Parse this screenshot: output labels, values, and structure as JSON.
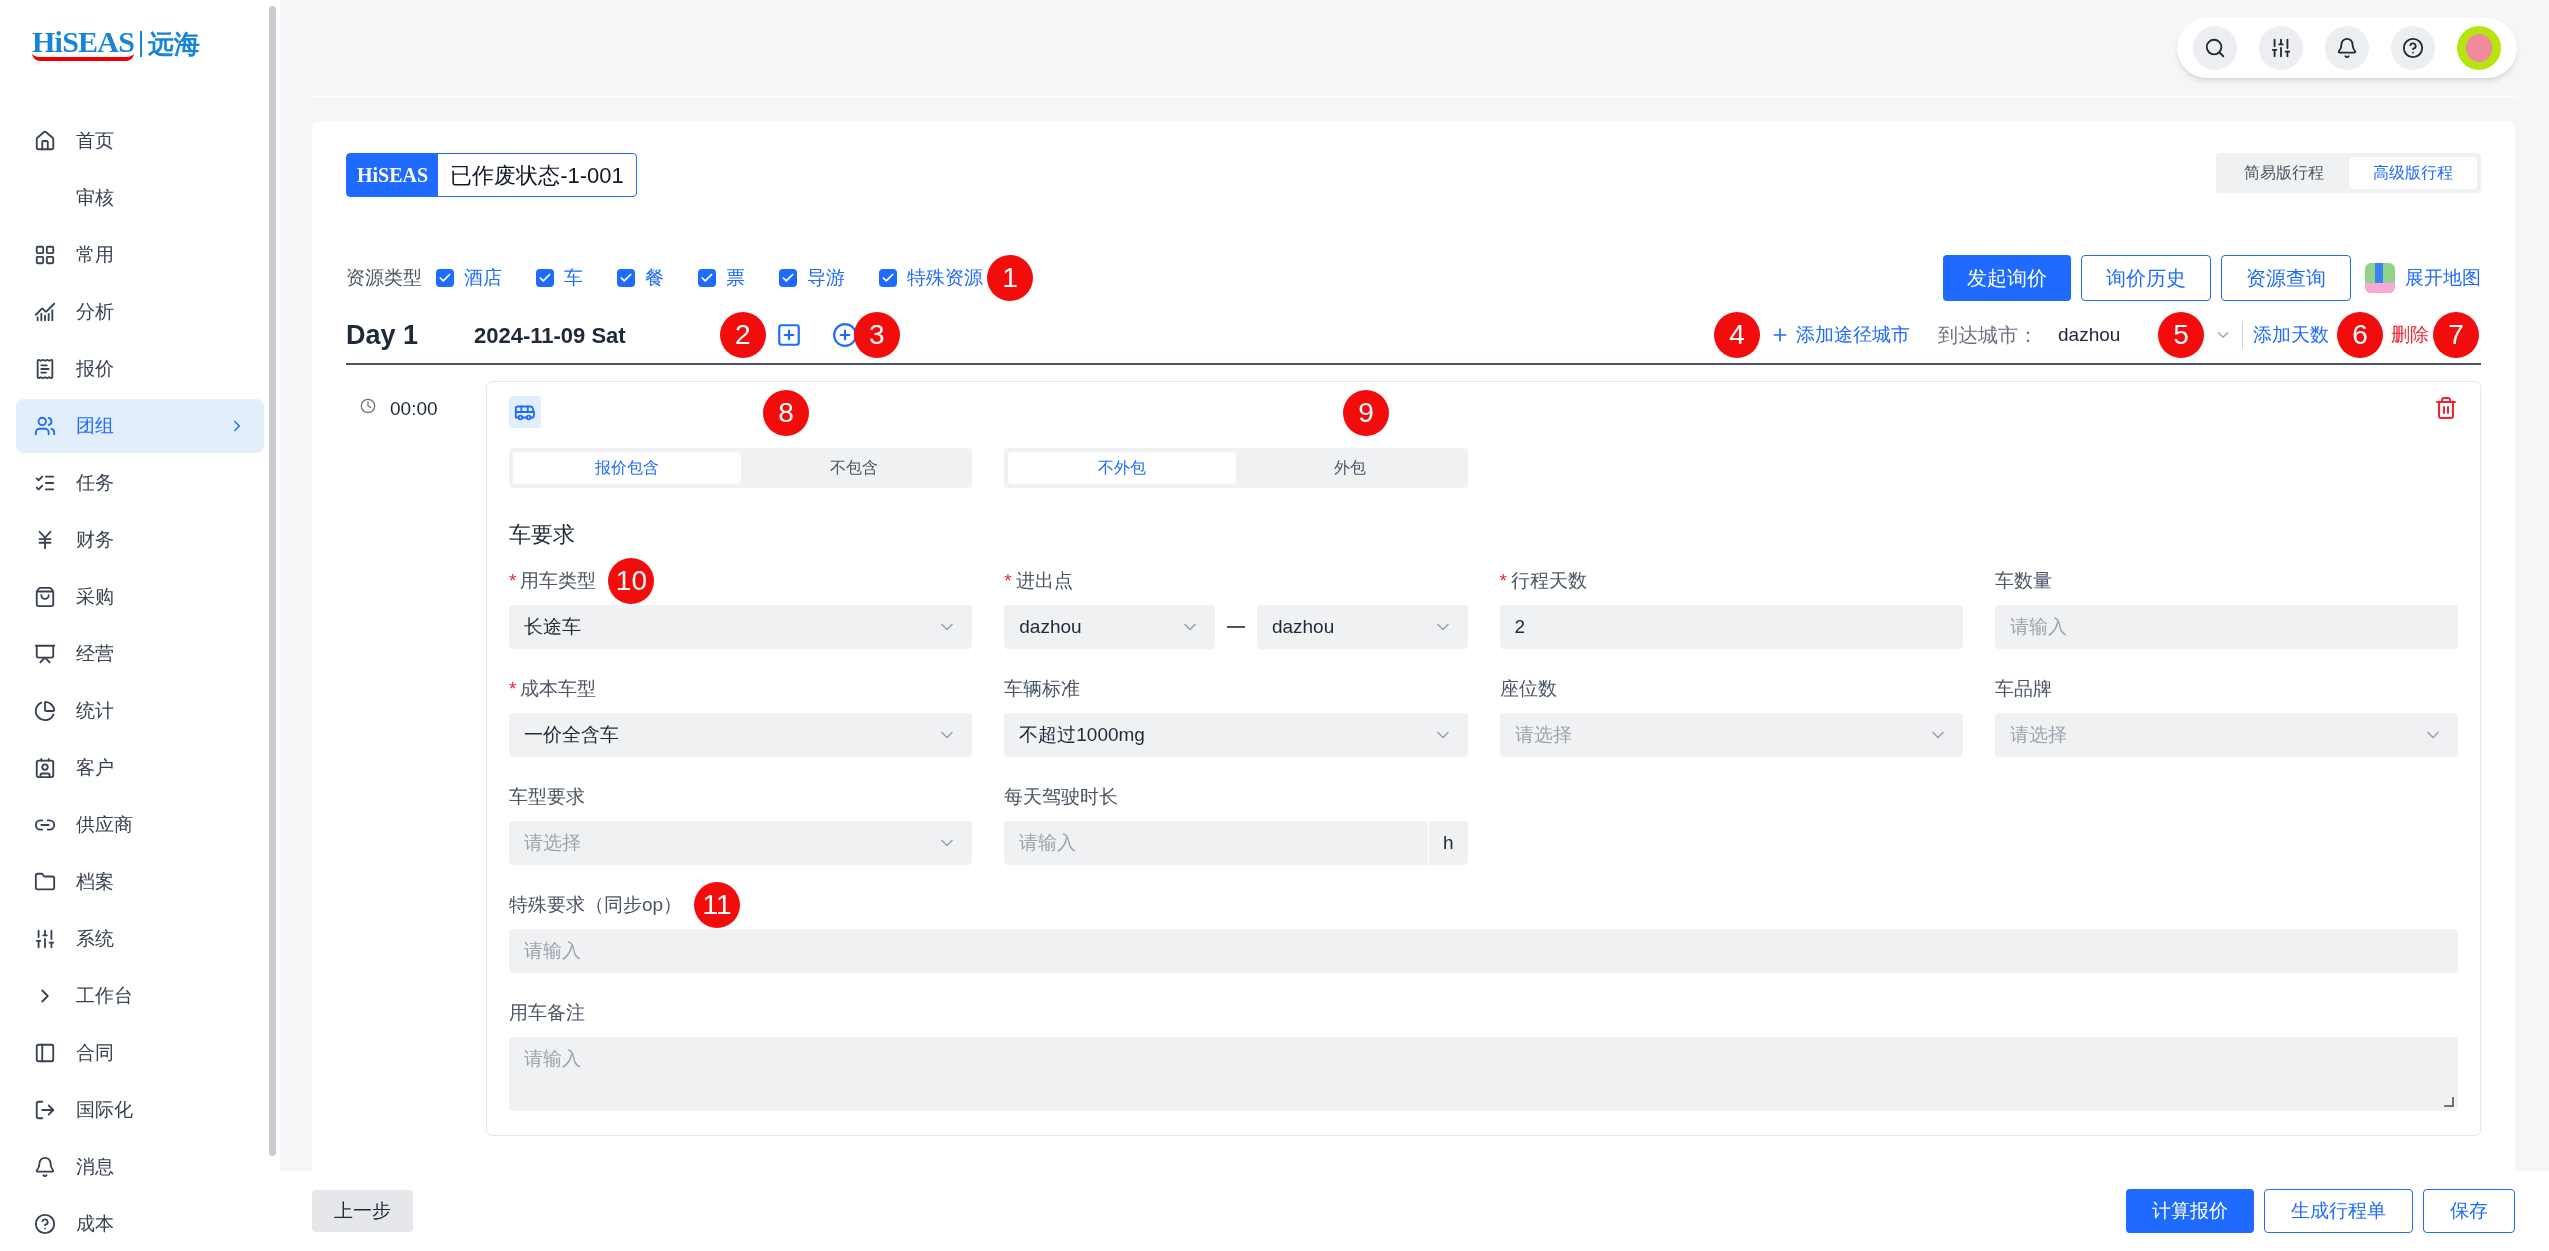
{
  "logo": {
    "latin": "HiSEAS",
    "chinese": "远海"
  },
  "sidebar": {
    "items": [
      {
        "label": "首页",
        "selected": false,
        "expandable": false
      },
      {
        "label": "审核",
        "selected": false,
        "expandable": false
      },
      {
        "label": "常用",
        "selected": false,
        "expandable": false
      },
      {
        "label": "分析",
        "selected": false,
        "expandable": false
      },
      {
        "label": "报价",
        "selected": false,
        "expandable": false
      },
      {
        "label": "团组",
        "selected": true,
        "expandable": true
      },
      {
        "label": "任务",
        "selected": false,
        "expandable": false
      },
      {
        "label": "财务",
        "selected": false,
        "expandable": false
      },
      {
        "label": "采购",
        "selected": false,
        "expandable": false
      },
      {
        "label": "经营",
        "selected": false,
        "expandable": false
      },
      {
        "label": "统计",
        "selected": false,
        "expandable": false
      },
      {
        "label": "客户",
        "selected": false,
        "expandable": false
      },
      {
        "label": "供应商",
        "selected": false,
        "expandable": false
      },
      {
        "label": "档案",
        "selected": false,
        "expandable": false
      },
      {
        "label": "系统",
        "selected": false,
        "expandable": false
      },
      {
        "label": "工作台",
        "selected": false,
        "expandable": false
      },
      {
        "label": "合同",
        "selected": false,
        "expandable": false
      },
      {
        "label": "国际化",
        "selected": false,
        "expandable": false
      },
      {
        "label": "消息",
        "selected": false,
        "expandable": false
      },
      {
        "label": "成本",
        "selected": false,
        "expandable": false
      }
    ]
  },
  "order": {
    "brand": "HiSEAS",
    "title": "已作废状态-1-001"
  },
  "view_toggle": [
    {
      "label": "简易版行程",
      "selected": false
    },
    {
      "label": "高级版行程",
      "selected": true
    }
  ],
  "resource_types": {
    "label": "资源类型",
    "options": [
      {
        "label": "酒店",
        "checked": true
      },
      {
        "label": "车",
        "checked": true
      },
      {
        "label": "餐",
        "checked": true
      },
      {
        "label": "票",
        "checked": true
      },
      {
        "label": "导游",
        "checked": true
      },
      {
        "label": "特殊资源",
        "checked": true
      }
    ]
  },
  "actions": [
    {
      "label": "发起询价",
      "primary": true
    },
    {
      "label": "询价历史",
      "primary": false
    },
    {
      "label": "资源查询",
      "primary": false
    }
  ],
  "map_link": "展开地图",
  "day": {
    "title": "Day 1",
    "date": "2024-11-09 Sat",
    "add_city": "添加途径城市",
    "arrival_label": "到达城市：",
    "arrival_value": "dazhou",
    "add_days": "添加天数",
    "delete": "删除"
  },
  "callouts": [
    "1",
    "2",
    "3",
    "4",
    "5",
    "6",
    "7",
    "8",
    "9",
    "10",
    "11"
  ],
  "timeline": {
    "time": "00:00"
  },
  "item": {
    "include_toggle": [
      {
        "label": "报价包含",
        "selected": true
      },
      {
        "label": "不包含",
        "selected": false
      }
    ],
    "outsource_toggle": [
      {
        "label": "不外包",
        "selected": true
      },
      {
        "label": "外包",
        "selected": false
      }
    ],
    "section": "车要求",
    "required_mark": "*",
    "fields": [
      {
        "kind": "select",
        "label": "用车类型",
        "required": true,
        "value": "长途车"
      },
      {
        "kind": "range",
        "label": "进出点",
        "required": true,
        "from": "dazhou",
        "to": "dazhou"
      },
      {
        "kind": "input",
        "label": "行程天数",
        "required": true,
        "value": "2"
      },
      {
        "kind": "input",
        "label": "车数量",
        "required": false,
        "placeholder": "请输入"
      },
      {
        "kind": "select",
        "label": "成本车型",
        "required": true,
        "value": "一价全含车"
      },
      {
        "kind": "select",
        "label": "车辆标准",
        "required": false,
        "value": "不超过1000mg"
      },
      {
        "kind": "select",
        "label": "座位数",
        "required": false,
        "placeholder": "请选择"
      },
      {
        "kind": "select",
        "label": "车品牌",
        "required": false,
        "placeholder": "请选择"
      },
      {
        "kind": "select",
        "label": "车型要求",
        "required": false,
        "placeholder": "请选择"
      },
      {
        "kind": "suffix",
        "label": "每天驾驶时长",
        "required": false,
        "placeholder": "请输入",
        "suffix": "h"
      },
      {
        "kind": "wide",
        "label": "特殊要求（同步op）",
        "required": false,
        "placeholder": "请输入"
      },
      {
        "kind": "textarea",
        "label": "用车备注",
        "required": false,
        "placeholder": "请输入"
      }
    ]
  },
  "footer": {
    "back": "上一步",
    "buttons": [
      {
        "label": "计算报价",
        "primary": true
      },
      {
        "label": "生成行程单",
        "primary": false
      },
      {
        "label": "保存",
        "primary": false
      }
    ]
  }
}
